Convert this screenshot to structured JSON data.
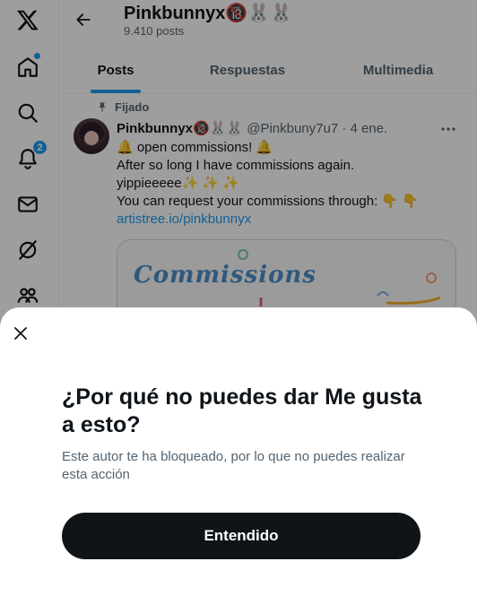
{
  "nav": {
    "items": [
      {
        "icon": "x-logo-icon"
      },
      {
        "icon": "home-icon",
        "has_dot": true
      },
      {
        "icon": "search-icon"
      },
      {
        "icon": "notifications-icon",
        "badge": "2"
      },
      {
        "icon": "messages-icon"
      },
      {
        "icon": "grok-icon"
      },
      {
        "icon": "communities-icon"
      }
    ]
  },
  "header": {
    "name": "Pinkbunnyx🔞🐰🐰",
    "posts_count": "9.410 posts"
  },
  "tabs": [
    {
      "label": "Posts",
      "active": true
    },
    {
      "label": "Respuestas",
      "active": false
    },
    {
      "label": "Multimedia",
      "active": false
    }
  ],
  "tweet": {
    "pinned_label": "Fijado",
    "display_name": "Pinkbunnyx🔞🐰🐰",
    "handle_date": "@Pinkbuny7u7 · 4 ene.",
    "lines": [
      "🔔 open commissions! 🔔",
      "After so long I have commissions again.",
      "yippieeeee✨ ✨ ✨",
      "You can request your commissions through: 👇 👇"
    ],
    "link": "artistree.io/pinkbunnyx",
    "media_text": "Commissions"
  },
  "dialog": {
    "title": "¿Por qué no puedes dar Me gusta a esto?",
    "description": "Este autor te ha bloqueado, por lo que no puedes realizar esta acción",
    "button_label": "Entendido"
  },
  "colors": {
    "accent": "#1d9bf0",
    "text": "#0f1419",
    "muted": "#536471",
    "button": "#0f1419"
  }
}
